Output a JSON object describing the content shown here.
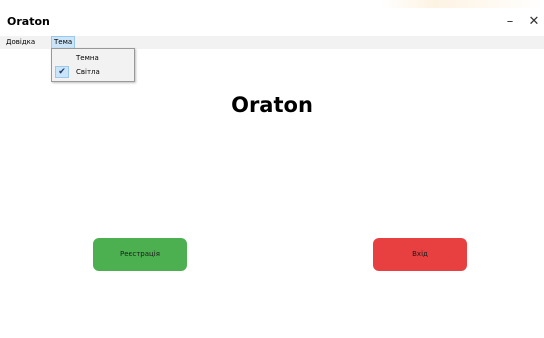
{
  "window": {
    "title": "Oraton",
    "minimize_symbol": "–",
    "close_symbol": "✕"
  },
  "menubar": {
    "items": [
      {
        "label": "Довідка"
      },
      {
        "label": "Тема"
      }
    ],
    "theme_dropdown": {
      "items": [
        {
          "label": "Темна",
          "checked": false
        },
        {
          "label": "Світла",
          "checked": true
        }
      ],
      "check_symbol": "✔"
    }
  },
  "main": {
    "title": "Oraton"
  },
  "buttons": {
    "register": {
      "label": "Реєстрація",
      "color": "#4cb050"
    },
    "login": {
      "label": "Вхід",
      "color": "#e84040"
    }
  }
}
